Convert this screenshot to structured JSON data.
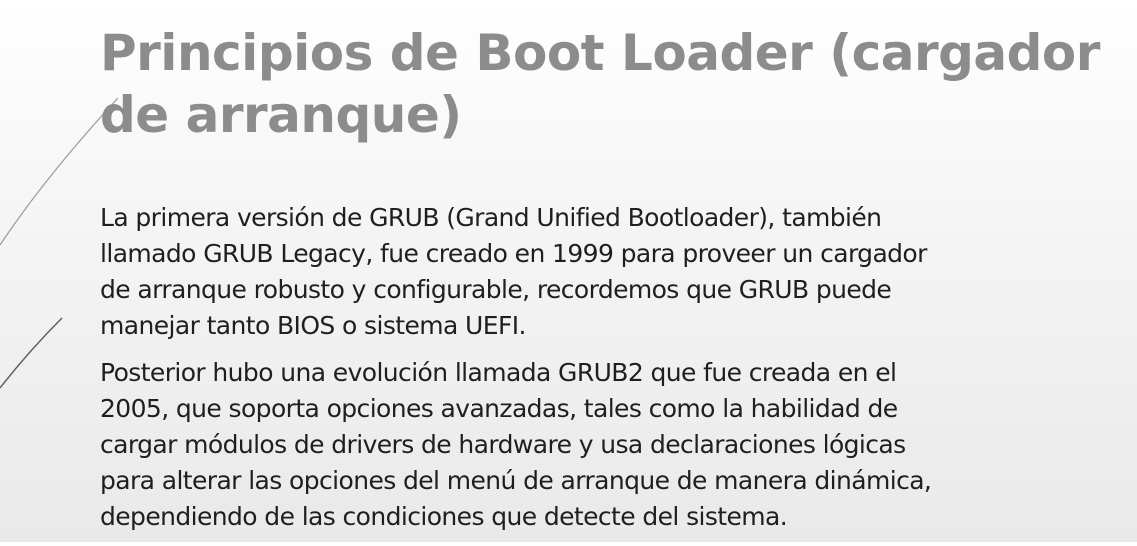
{
  "slide": {
    "title": "Principios de Boot Loader (cargador de arranque)",
    "paragraphs": [
      {
        "lines": [
          "La primera versión de GRUB (Grand Unified Bootloader), también",
          "llamado GRUB Legacy, fue creado en 1999 para proveer un cargador",
          "de arranque robusto y configurable, recordemos que GRUB puede",
          "manejar tanto BIOS o sistema UEFI."
        ]
      },
      {
        "lines": [
          "Posterior hubo una evolución llamada GRUB2 que fue creada en el",
          "2005, que soporta opciones avanzadas, tales como la habilidad de",
          "cargar módulos de drivers de hardware y usa declaraciones lógicas",
          "para alterar las opciones del menú de arranque de manera dinámica,",
          "dependiendo de las condiciones que detecte del sistema."
        ]
      }
    ]
  },
  "colors": {
    "title": "#8c8c8c",
    "body_text": "#1f1f1f",
    "decorative_lines": "#9a9a9a"
  }
}
